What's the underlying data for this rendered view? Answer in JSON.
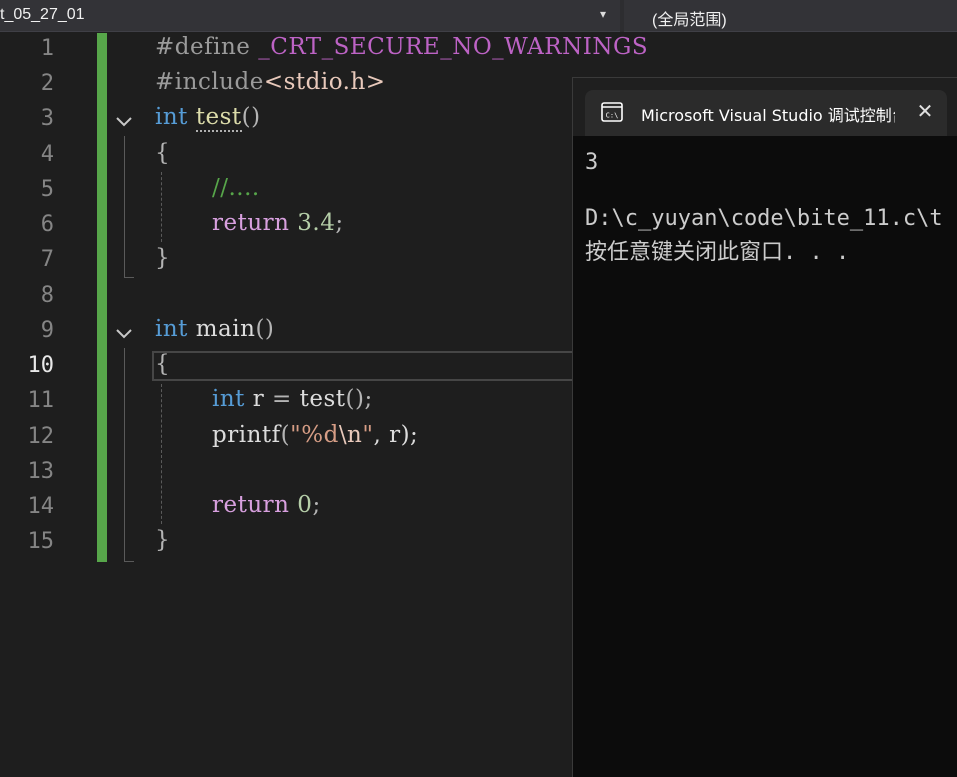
{
  "navbar": {
    "project_dropdown": "t_05_27_01",
    "scope_dropdown": "(全局范围)"
  },
  "editor": {
    "active_line": 10,
    "line_numbers": [
      "1",
      "2",
      "3",
      "4",
      "5",
      "6",
      "7",
      "8",
      "9",
      "10",
      "11",
      "12",
      "13",
      "14",
      "15"
    ],
    "lines": {
      "l1": {
        "t1": "#define",
        "t2": " _CRT_SECURE_NO_WARNINGS"
      },
      "l2": {
        "t1": "#include",
        "t2": "<stdio.h>"
      },
      "l3": {
        "t1": "int",
        "t2": " ",
        "t3": "test",
        "t4": "()"
      },
      "l4": {
        "t1": "{"
      },
      "l5": {
        "t1": "//...."
      },
      "l6": {
        "t1": "return",
        "t2": " ",
        "t3": "3.4",
        "t4": ";"
      },
      "l7": {
        "t1": "}"
      },
      "l9": {
        "t1": "int",
        "t2": " main",
        "t3": "()"
      },
      "l10": {
        "t1": "{"
      },
      "l11": {
        "t1": "int",
        "t2": " r ",
        "t3": "=",
        "t4": " test",
        "t5": "();"
      },
      "l12": {
        "t1": "printf",
        "t2": "(",
        "t3": "\"",
        "t4": "%d",
        "t5": "\\n",
        "t6": "\"",
        "t7": ", r);"
      },
      "l14": {
        "t1": "return",
        "t2": " ",
        "t3": "0",
        "t4": ";"
      },
      "l15": {
        "t1": "}"
      }
    }
  },
  "console": {
    "tab_title": "Microsoft Visual Studio 调试控制台",
    "output": [
      "3",
      "",
      "D:\\c_yuyan\\code\\bite_11.c\\t",
      "按任意键关闭此窗口. . ."
    ]
  }
}
